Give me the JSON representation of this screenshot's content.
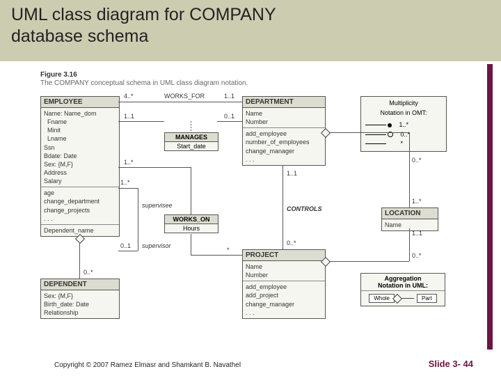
{
  "title_line1": "UML class diagram for COMPANY",
  "title_line2": "database schema",
  "figure_label": "Figure 3.16",
  "figure_caption": "The COMPANY conceptual schema in UML class diagram notation.",
  "footer_left": "Copyright © 2007 Ramez Elmasr and Shamkant B. Navathel",
  "footer_right": "Slide 3- 44",
  "employee": {
    "header": "EMPLOYEE",
    "attrs": "Name: Name_dom\n  Fname\n  Minit\n  Lname\nSsn\nBdate: Date\nSex: {M,F}\nAddress\nSalary",
    "ops": "age\nchange_department\nchange_projects\n. . .",
    "extra": "Dependent_name"
  },
  "department": {
    "header": "DEPARTMENT",
    "attrs": "Name\nNumber",
    "ops": "add_employee\nnumber_of_employees\nchange_manager\n. . ."
  },
  "project": {
    "header": "PROJECT",
    "attrs": "Name\nNumber",
    "ops": "add_employee\nadd_project\nchange_manager\n. . ."
  },
  "location": {
    "header": "LOCATION",
    "attrs": "Name"
  },
  "dependent": {
    "header": "DEPENDENT",
    "attrs": "Sex: {M,F}\nBirth_date: Date\nRelationship"
  },
  "manages": {
    "header": "MANAGES",
    "row": "Start_date"
  },
  "workson": {
    "header": "WORKS_ON",
    "row": "Hours"
  },
  "labels": {
    "works_for": "WORKS_FOR",
    "controls": "CONTROLS",
    "supervisee": "supervisee",
    "supervisor": "supervisor",
    "m_4star": "4..*",
    "m_1_1": "1..1",
    "m_0_1": "0..1",
    "m_1star": "1..*",
    "m_0star": "0..*",
    "m_star": "*"
  },
  "legend_mult": {
    "title": "Multiplicity\nNotation in OMT:",
    "r1": "1..*",
    "r2": "0..*",
    "r3": "*"
  },
  "legend_agg": {
    "title": "Aggregation\nNotation in UML:",
    "whole": "Whole",
    "part": "Part"
  }
}
